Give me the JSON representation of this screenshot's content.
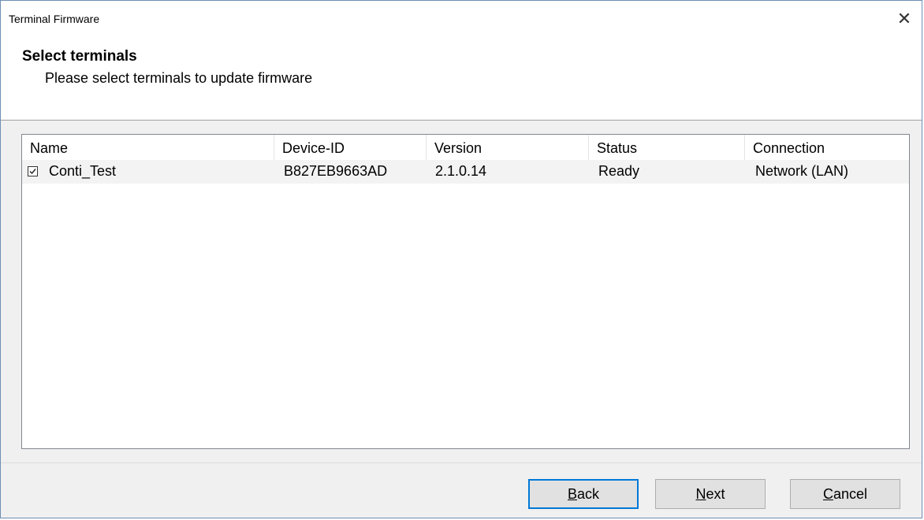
{
  "window": {
    "title": "Terminal Firmware",
    "close_glyph": "✕"
  },
  "header": {
    "title": "Select terminals",
    "subtitle": "Please select terminals to update firmware"
  },
  "table": {
    "columns": [
      "Name",
      "Device-ID",
      "Version",
      "Status",
      "Connection"
    ],
    "rows": [
      {
        "checked": true,
        "name": "Conti_Test",
        "device_id": "B827EB9663AD",
        "version": "2.1.0.14",
        "status": "Ready",
        "connection": "Network (LAN)"
      }
    ]
  },
  "buttons": {
    "back": {
      "mnemonic": "B",
      "rest": "ack"
    },
    "next": {
      "mnemonic": "N",
      "rest": "ext"
    },
    "cancel": {
      "mnemonic": "C",
      "rest": "ancel"
    }
  },
  "colors": {
    "default_button_border": "#0078d7",
    "window_border": "#6d8fb3"
  }
}
